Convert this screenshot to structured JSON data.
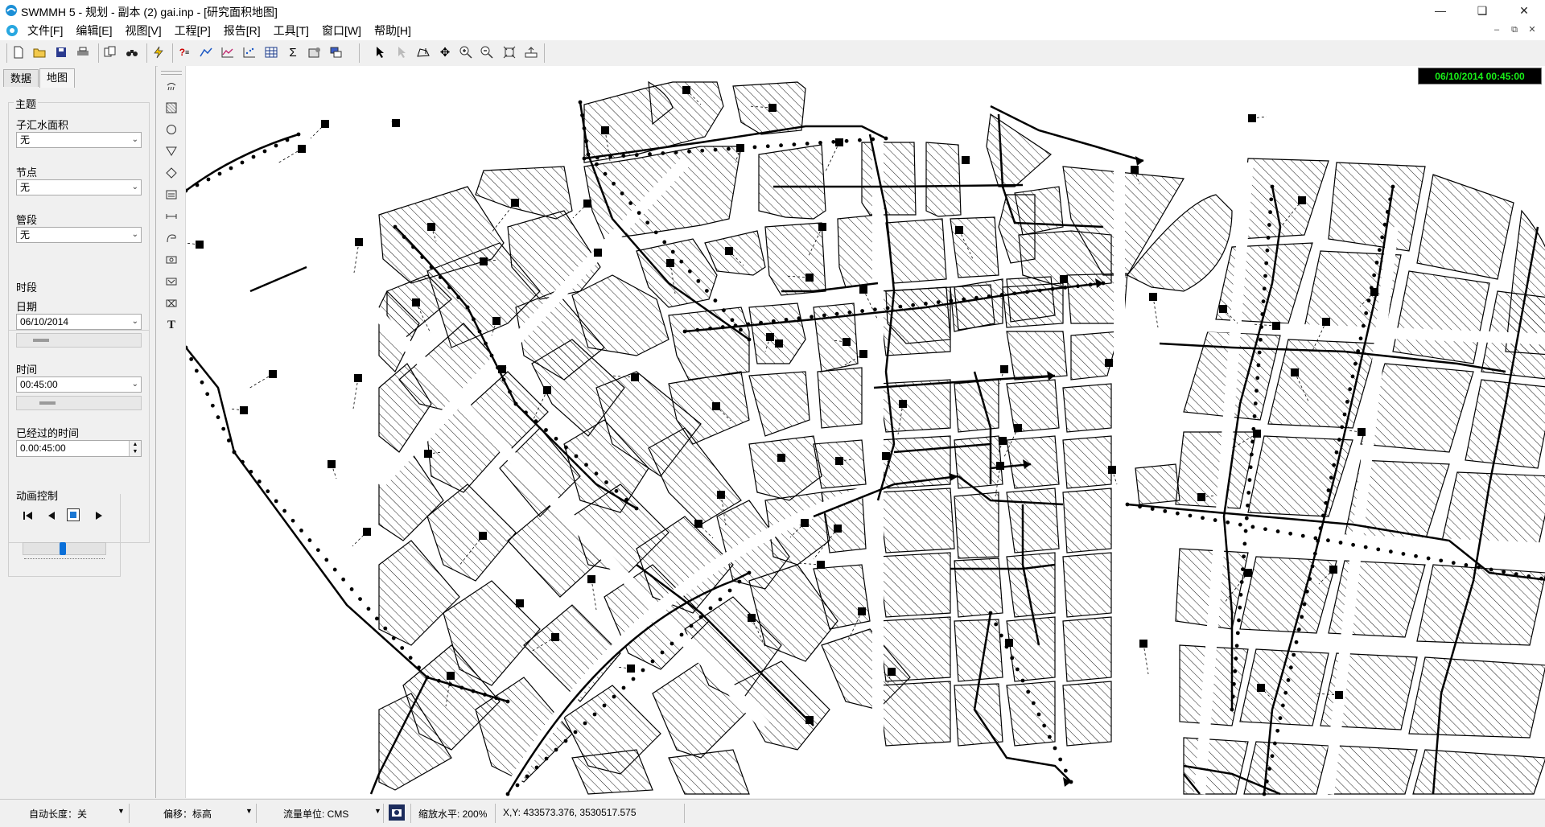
{
  "window": {
    "title": "SWMMH 5 - 规划 - 副本 (2) gai.inp - [研究面积地图]",
    "min_icon": "minimize-icon",
    "max_icon": "maximize-icon",
    "close_icon": "close-icon"
  },
  "menu": {
    "items": [
      "文件[F]",
      "编辑[E]",
      "视图[V]",
      "工程[P]",
      "报告[R]",
      "工具[T]",
      "窗口[W]",
      "帮助[H]"
    ]
  },
  "toolbar": {
    "icons": [
      "new-file-icon",
      "open-folder-icon",
      "save-icon",
      "print-icon",
      "copy-icon",
      "find-icon",
      "run-icon",
      "query-icon",
      "profile-plot-icon",
      "time-series-plot-icon",
      "scatter-plot-icon",
      "table-icon",
      "statistics-icon",
      "options-icon",
      "cascade-windows-icon",
      "select-object-icon",
      "select-vertex-icon",
      "select-region-icon",
      "pan-icon",
      "zoom-in-icon",
      "zoom-out-icon",
      "full-extent-icon",
      "measure-icon"
    ]
  },
  "left_panel": {
    "tabs": [
      "数据",
      "地图"
    ],
    "active_tab": "地图",
    "theme_group": {
      "title": "主题",
      "subcatch_label": "子汇水面积",
      "subcatch_value": "无",
      "node_label": "节点",
      "node_value": "无",
      "link_label": "管段",
      "link_value": "无"
    },
    "time_group": {
      "title": "时段",
      "date_label": "日期",
      "date_value": "06/10/2014",
      "time_label": "时间",
      "time_value": "00:45:00",
      "elapsed_label": "已经过的时间",
      "elapsed_value": "0.00:45:00"
    },
    "animation_group": {
      "title": "动画控制",
      "speed_fraction": 0.48
    }
  },
  "map": {
    "datetime_display": "06/10/2014 00:45:00",
    "tools": [
      "rain-gage-icon",
      "subcatchment-icon",
      "junction-icon",
      "outfall-icon",
      "divider-icon",
      "storage-icon",
      "conduit-icon",
      "pump-icon",
      "orifice-icon",
      "weir-icon",
      "outlet-icon",
      "label-icon"
    ],
    "accent_color": "#19f019"
  },
  "status": {
    "auto_length": "自动长度：关",
    "offset": "偏移：标高",
    "flow_units": "流量单位: CMS",
    "zoom": "缩放水平: 200%",
    "xy": "X,Y: 433573.376, 3530517.575"
  }
}
